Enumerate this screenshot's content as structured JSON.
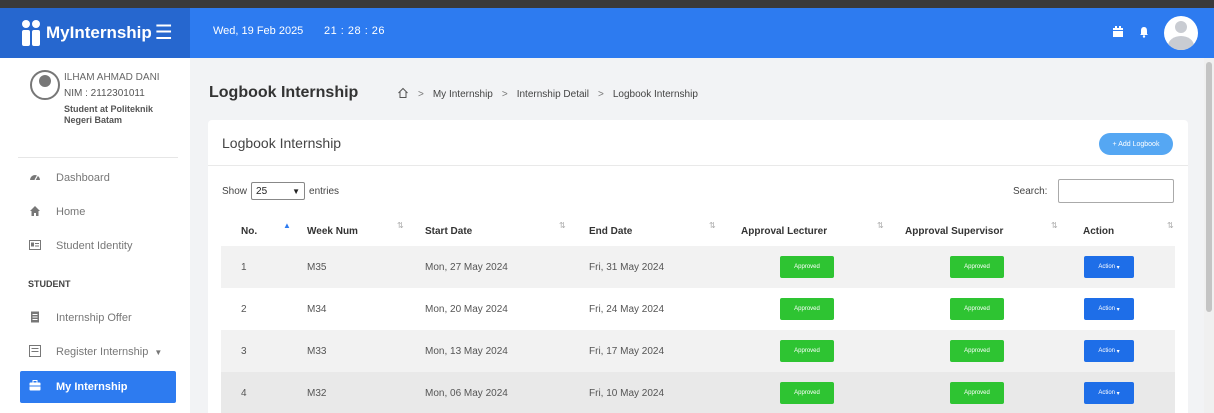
{
  "header": {
    "brand": "MyInternship",
    "date": "Wed, 19 Feb 2025",
    "time": "21 : 28 : 26"
  },
  "profile": {
    "name": "ILHAM AHMAD DANI",
    "nim": "NIM : 2112301011",
    "school": "Student at Politeknik Negeri Batam"
  },
  "sidebar": {
    "items": [
      {
        "label": "Dashboard",
        "icon": "dashboard-icon"
      },
      {
        "label": "Home",
        "icon": "home-icon"
      },
      {
        "label": "Student Identity",
        "icon": "id-card-icon"
      },
      {
        "label": "Internship Offer",
        "icon": "document-icon"
      },
      {
        "label": "Register Internship",
        "icon": "form-icon"
      },
      {
        "label": "My Internship",
        "icon": "briefcase-icon"
      }
    ],
    "section": "STUDENT"
  },
  "page": {
    "title": "Logbook Internship",
    "breadcrumb": [
      "My Internship",
      "Internship Detail",
      "Logbook Internship"
    ]
  },
  "card": {
    "title": "Logbook Internship",
    "add_button": "+ Add Logbook"
  },
  "table_controls": {
    "show": "Show",
    "entries_value": "25",
    "entries": "entries",
    "search": "Search:"
  },
  "table": {
    "columns": [
      "No.",
      "Week Num",
      "Start Date",
      "End Date",
      "Approval Lecturer",
      "Approval Supervisor",
      "Action"
    ],
    "rows": [
      {
        "no": "1",
        "week": "M35",
        "start": "Mon, 27 May 2024",
        "end": "Fri, 31 May 2024",
        "lecturer": "Approved",
        "supervisor": "Approved",
        "action": "Action"
      },
      {
        "no": "2",
        "week": "M34",
        "start": "Mon, 20 May 2024",
        "end": "Fri, 24 May 2024",
        "lecturer": "Approved",
        "supervisor": "Approved",
        "action": "Action"
      },
      {
        "no": "3",
        "week": "M33",
        "start": "Mon, 13 May 2024",
        "end": "Fri, 17 May 2024",
        "lecturer": "Approved",
        "supervisor": "Approved",
        "action": "Action"
      },
      {
        "no": "4",
        "week": "M32",
        "start": "Mon, 06 May 2024",
        "end": "Fri, 10 May 2024",
        "lecturer": "Approved",
        "supervisor": "Approved",
        "action": "Action"
      }
    ]
  },
  "colors": {
    "primary": "#2d7bf0",
    "brand_bg": "#2667cf",
    "approved": "#2ec432",
    "action": "#1e6ee8",
    "add_button": "#55a7f3"
  }
}
